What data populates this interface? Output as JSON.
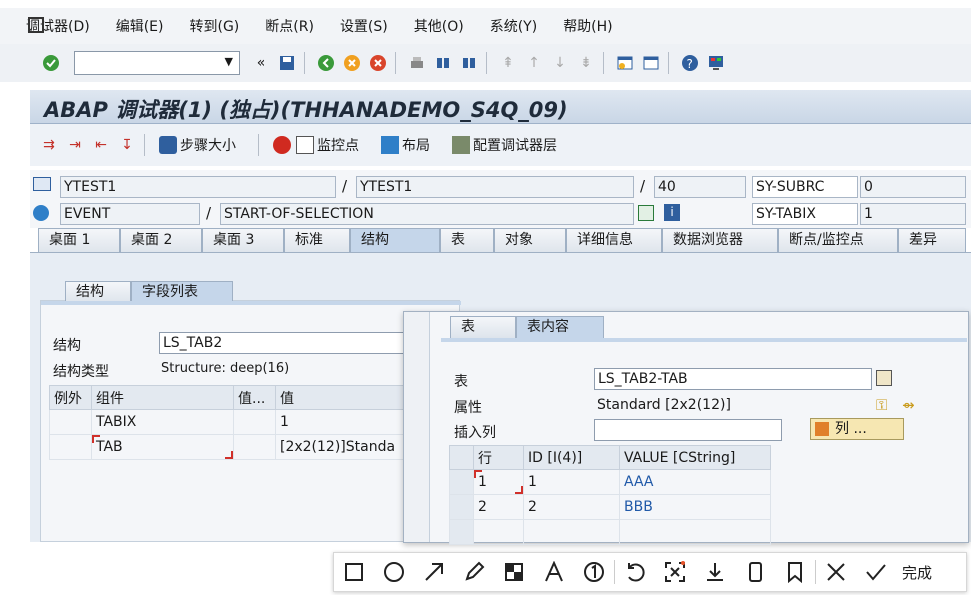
{
  "menu": [
    "调试器(D)",
    "编辑(E)",
    "转到(G)",
    "断点(R)",
    "设置(S)",
    "其他(O)",
    "系统(Y)",
    "帮助(H)"
  ],
  "window_title": "ABAP 调试器(1) (独占)(THHANADEMO_S4Q_09)",
  "app_toolbar": {
    "step_size": "步骤大小",
    "watchpoint": "监控点",
    "layout": "布局",
    "config_layer": "配置调试器层"
  },
  "info": {
    "program1": "YTEST1",
    "program2": "YTEST1",
    "line": "40",
    "subrc_label": "SY-SUBRC",
    "subrc_value": "0",
    "event_type": "EVENT",
    "event_name": "START-OF-SELECTION",
    "tabix_label": "SY-TABIX",
    "tabix_value": "1"
  },
  "tabs": [
    "桌面 1",
    "桌面 2",
    "桌面 3",
    "标准",
    "结构",
    "表",
    "对象",
    "详细信息",
    "数据浏览器",
    "断点/监控点",
    "差异"
  ],
  "structure_panel": {
    "subtabs": [
      "结构",
      "字段列表"
    ],
    "struct_label": "结构",
    "struct_value": "LS_TAB2",
    "type_label": "结构类型",
    "type_value": "Structure: deep(16)",
    "columns": [
      "例外",
      "组件",
      "值...",
      "值"
    ],
    "rows": [
      {
        "component": "TABIX",
        "value": "1"
      },
      {
        "component": "TAB",
        "value": "[2x2(12)]Standa"
      }
    ]
  },
  "table_panel": {
    "subtabs": [
      "表",
      "表内容"
    ],
    "table_label": "表",
    "table_value": "LS_TAB2-TAB",
    "attr_label": "属性",
    "attr_value": "Standard [2x2(12)]",
    "insert_label": "插入列",
    "columns_button": "列 ...",
    "columns": [
      "行",
      "ID [I(4)]",
      "VALUE [CString]"
    ],
    "rows": [
      {
        "row": "1",
        "id": "1",
        "value": "AAA"
      },
      {
        "row": "2",
        "id": "2",
        "value": "BBB"
      }
    ]
  },
  "snap_toolbar": {
    "done": "完成"
  }
}
